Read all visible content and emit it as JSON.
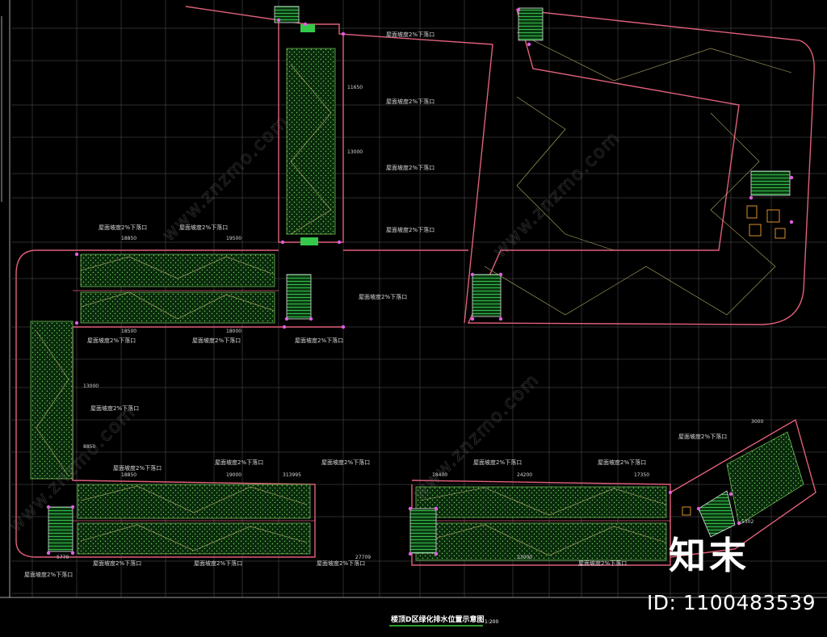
{
  "drawing": {
    "title": "楼顶D区绿化排水位置示意图",
    "scale": "1:200"
  },
  "slope_note": "屋面坡度2%下落口",
  "dimensions": [
    "18850",
    "19500",
    "18500",
    "18000",
    "18850",
    "19000",
    "313995",
    "18400",
    "24200",
    "17350",
    "5770",
    "27709",
    "23000",
    "5302",
    "3000",
    "13000",
    "8850",
    "11650",
    "13000"
  ],
  "watermark": {
    "site": "www.znzmo.com",
    "brand_text": "知末",
    "id_text": "ID: 1100483539"
  },
  "colors": {
    "background": "#000000",
    "wall": "#e0607a",
    "grid": "#8a8a8a",
    "planting": "#7fd060",
    "slope": "#c8c070",
    "stair": "#35c84a",
    "node": "#e060e0"
  }
}
